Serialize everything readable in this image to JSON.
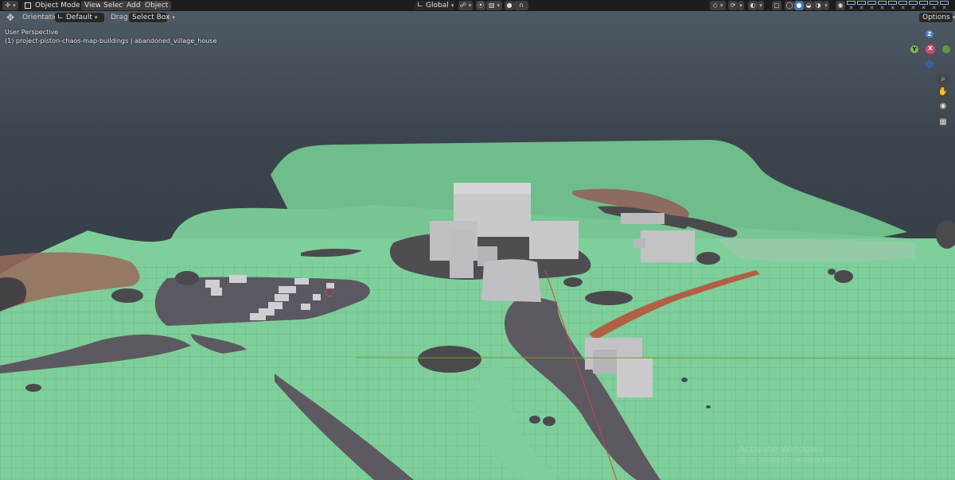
{
  "header": {
    "editor_type_icon": "cursor-icon",
    "mode_label": "Object Mode",
    "menu": [
      "View",
      "Select",
      "Add",
      "Object"
    ],
    "transform_orientation": "Global",
    "options_label": "Options"
  },
  "tool_settings": {
    "orientation_label": "Orientation:",
    "orientation_value": "Default",
    "drag_label": "Drag:",
    "drag_value": "Select Box"
  },
  "viewport": {
    "view_name": "User Perspective",
    "collection_info": "(1) project-piston-chaos-map-buildings | abandoned_village_house",
    "gizmo_axes": {
      "z": "Z",
      "y": "Y",
      "x": "X"
    }
  },
  "watermark": {
    "title": "Activate Windows",
    "subtitle": "Go to Settings to activate Windows."
  },
  "colors": {
    "terrain": "#7fcf9a",
    "terrain_dark": "#6aba86",
    "road": "#5d5960",
    "path": "#9a5a4a",
    "building": "#c9c9cc",
    "rock": "#4a4a4e",
    "sky_top": "#4f5b66",
    "header_bg": "#1d1d1d",
    "accent": "#4772b3"
  }
}
